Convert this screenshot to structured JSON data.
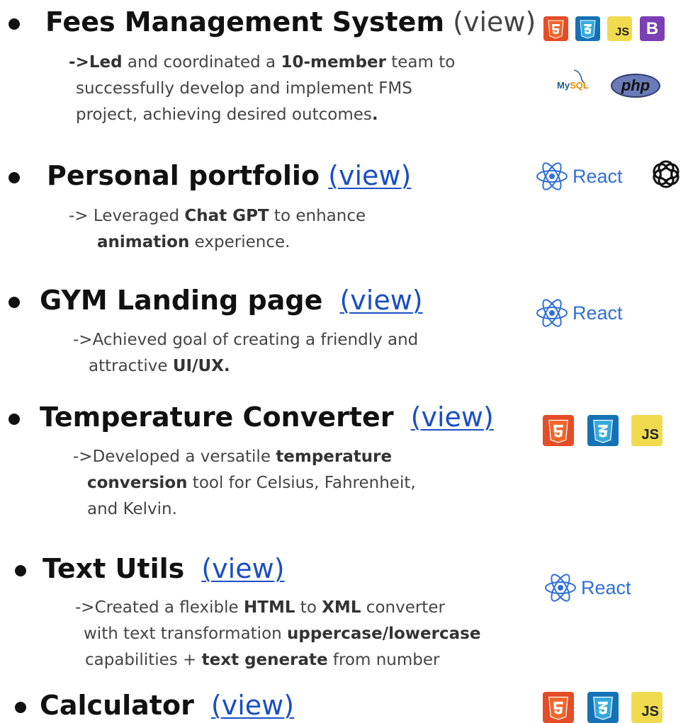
{
  "projects": [
    {
      "title": "Fees Management System",
      "paren_open": "(",
      "view_label": "view",
      "paren_close": ")",
      "desc": {
        "l1_a": "->Led",
        "l1_b": " and coordinated a ",
        "l1_c": "10-member",
        "l1_d": " team to",
        "l2": "successfully develop and implement FMS",
        "l3_a": "project, achieving desired outcomes",
        "l3_b": "."
      },
      "tech": [
        "html5-icon",
        "css3-icon",
        "JS",
        "B",
        "MySQL",
        "php"
      ]
    },
    {
      "title": "Personal portfolio",
      "paren_open": "(",
      "view_label": "view",
      "paren_close": ")",
      "desc": {
        "l1_a": "-> Leveraged ",
        "l1_b": "Chat GPT",
        "l1_c": " to enhance",
        "l2_a": "animation",
        "l2_b": " experience."
      },
      "tech": [
        "React",
        "chatgpt-icon"
      ]
    },
    {
      "title": "GYM Landing page",
      "paren_open": "(",
      "view_label": "view",
      "paren_close": ")",
      "desc": {
        "l1": "->Achieved goal of creating a friendly and",
        "l2_a": "attractive ",
        "l2_b": "UI/UX."
      },
      "tech": [
        "React"
      ]
    },
    {
      "title": "Temperature Converter",
      "paren_open": "(",
      "view_label": "view",
      "paren_close": ")",
      "desc": {
        "l1_a": "->Developed a versatile ",
        "l1_b": "temperature",
        "l2_a": "conversion",
        "l2_b": " tool for Celsius, Fahrenheit,",
        "l3": "and Kelvin."
      },
      "tech": [
        "html5-icon",
        "css3-icon",
        "JS"
      ]
    },
    {
      "title": "Text Utils",
      "paren_open": "(",
      "view_label": "view",
      "paren_close": ")",
      "desc": {
        "l1_a": "->Created a flexible ",
        "l1_b": "HTML",
        "l1_c": " to ",
        "l1_d": "XML",
        "l1_e": " converter",
        "l2_a": "with text transformation ",
        "l2_b": "uppercase/lowercase",
        "l3_a": "capabilities + ",
        "l3_b": "text generate",
        "l3_c": " from number"
      },
      "tech": [
        "React"
      ]
    },
    {
      "title": "Calculator",
      "paren_open": "(",
      "view_label": "view",
      "paren_close": ")",
      "tech": [
        "html5-icon",
        "css3-icon",
        "JS"
      ]
    }
  ],
  "tech_labels": {
    "js": "JS",
    "bootstrap": "B",
    "react": "React",
    "mysql_my": "My",
    "mysql_sql": "SQL",
    "php": "php"
  },
  "colors": {
    "link": "#1a4fc4",
    "html5": "#e44d26",
    "css3": "#1572b6",
    "js": "#f0db4f",
    "bootstrap": "#7b3fb6",
    "react": "#2f6fd8"
  }
}
